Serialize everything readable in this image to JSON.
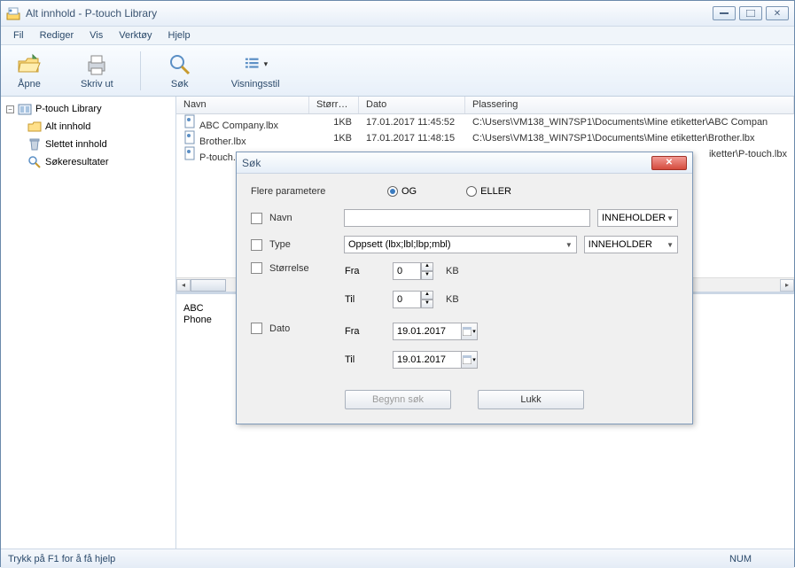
{
  "window": {
    "title": "Alt innhold - P-touch Library"
  },
  "menu": {
    "file": "Fil",
    "edit": "Rediger",
    "view": "Vis",
    "tools": "Verktøy",
    "help": "Hjelp"
  },
  "toolbar": {
    "open": "Åpne",
    "print": "Skriv ut",
    "search": "Søk",
    "viewstyle": "Visningsstil"
  },
  "tree": {
    "root": "P-touch Library",
    "all": "Alt innhold",
    "deleted": "Slettet innhold",
    "results": "Søkeresultater"
  },
  "columns": {
    "name": "Navn",
    "size": "Størrelse",
    "date": "Dato",
    "location": "Plassering"
  },
  "rows": [
    {
      "name": "ABC Company.lbx",
      "size": "1KB",
      "date": "17.01.2017 11:45:52",
      "location": "C:\\Users\\VM138_WIN7SP1\\Documents\\Mine etiketter\\ABC Compan"
    },
    {
      "name": "Brother.lbx",
      "size": "1KB",
      "date": "17.01.2017 11:48:15",
      "location": "C:\\Users\\VM138_WIN7SP1\\Documents\\Mine etiketter\\Brother.lbx"
    },
    {
      "name": "P-touch.",
      "size": "",
      "date": "",
      "location": "iketter\\P-touch.lbx"
    }
  ],
  "preview": {
    "line1": "ABC",
    "line2": "Phone"
  },
  "status": {
    "help": "Trykk på F1 for å få hjelp",
    "num": "NUM"
  },
  "dialog": {
    "title": "Søk",
    "params_label": "Flere parametere",
    "and": "OG",
    "or": "ELLER",
    "name": "Navn",
    "type": "Type",
    "type_value": "Oppsett (lbx;lbl;lbp;mbl)",
    "contains": "INNEHOLDER",
    "size": "Størrelse",
    "from": "Fra",
    "to": "Til",
    "size_from_val": "0",
    "size_to_val": "0",
    "kb": "KB",
    "date": "Dato",
    "date_from_val": "19.01.2017",
    "date_to_val": "19.01.2017",
    "begin": "Begynn søk",
    "close": "Lukk"
  }
}
